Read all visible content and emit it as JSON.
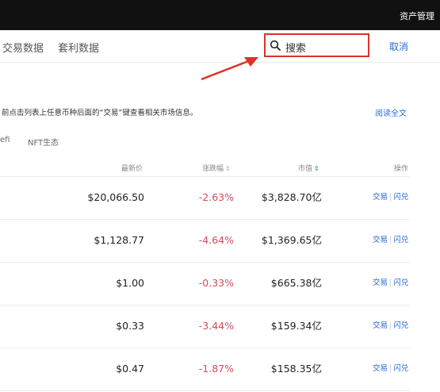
{
  "header": {
    "asset_management": "资产管理"
  },
  "nav": {
    "tabs": [
      "交易数据",
      "套利数据"
    ]
  },
  "search": {
    "placeholder": "搜索",
    "cancel": "取消"
  },
  "notice": {
    "text": "前点击列表上任意币种后面的“交易”键查看相关市场信息。",
    "read_more": "阅读全文"
  },
  "subtabs": [
    "efi",
    "NFT生态"
  ],
  "table": {
    "columns": {
      "latest_price": "最新价",
      "change": "涨跌幅",
      "market_cap": "市值",
      "actions": "操作"
    },
    "rows": [
      {
        "price": "$20,066.50",
        "change": "-2.63%",
        "market_cap": "$3,828.70亿",
        "trade": "交易",
        "flash": "闪兑"
      },
      {
        "price": "$1,128.77",
        "change": "-4.64%",
        "market_cap": "$1,369.65亿",
        "trade": "交易",
        "flash": "闪兑"
      },
      {
        "price": "$1.00",
        "change": "-0.33%",
        "market_cap": "$665.38亿",
        "trade": "交易",
        "flash": "闪兑"
      },
      {
        "price": "$0.33",
        "change": "-3.44%",
        "market_cap": "$159.34亿",
        "trade": "交易",
        "flash": "闪兑"
      },
      {
        "price": "$0.47",
        "change": "-1.87%",
        "market_cap": "$158.35亿",
        "trade": "交易",
        "flash": "闪兑"
      }
    ]
  },
  "colors": {
    "accent_blue": "#2b6bd6",
    "negative_red": "#d24b5a",
    "highlight_red": "#d9342b"
  }
}
